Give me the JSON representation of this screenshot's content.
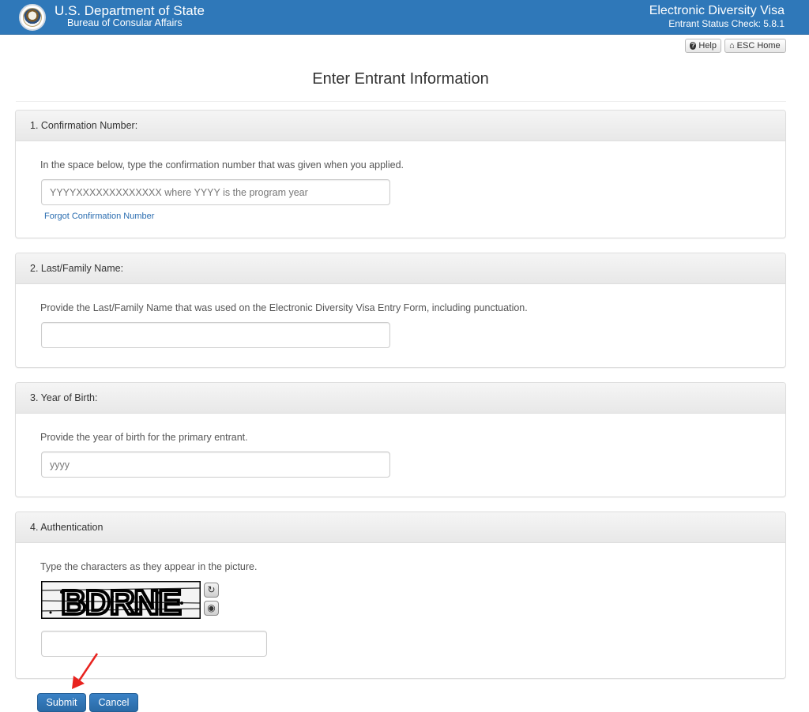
{
  "header": {
    "agency_title": "U.S. Department of State",
    "agency_subtitle": "Bureau of Consular Affairs",
    "app_title": "Electronic Diversity Visa",
    "app_subtitle": "Entrant Status Check: 5.8.1",
    "brand_color": "#2f78b9"
  },
  "toolbar": {
    "help_label": "Help",
    "help_icon": "question-circle-icon",
    "home_label": "ESC Home",
    "home_icon": "home-icon"
  },
  "page": {
    "title": "Enter Entrant Information"
  },
  "sections": {
    "confirmation": {
      "heading": "1. Confirmation Number:",
      "instruction": "In the space below, type the confirmation number that was given when you applied.",
      "placeholder": "YYYYXXXXXXXXXXXXX where YYYY is the program year",
      "value": "",
      "link": "Forgot Confirmation Number"
    },
    "last_name": {
      "heading": "2. Last/Family Name:",
      "instruction": "Provide the Last/Family Name that was used on the Electronic Diversity Visa Entry Form, including punctuation.",
      "placeholder": "",
      "value": ""
    },
    "birth_year": {
      "heading": "3. Year of Birth:",
      "instruction": "Provide the year of birth for the primary entrant.",
      "placeholder": "yyyy",
      "value": ""
    },
    "authentication": {
      "heading": "4. Authentication",
      "instruction": "Type the characters as they appear in the picture.",
      "captcha_text": "BDRNE",
      "refresh_icon": "refresh-icon",
      "audio_icon": "audio-icon",
      "value": ""
    }
  },
  "actions": {
    "submit_label": "Submit",
    "cancel_label": "Cancel",
    "accent_color": "#2f78b9",
    "annotation_color": "#e8231f"
  }
}
